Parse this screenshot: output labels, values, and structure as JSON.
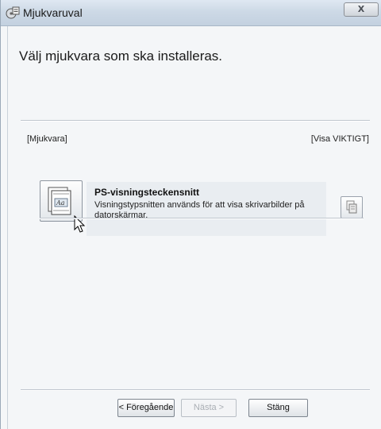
{
  "window": {
    "title": "Mjukvaruval",
    "close_label": "X"
  },
  "page": {
    "heading": "Välj mjukvara som ska installeras."
  },
  "list": {
    "left_header": "[Mjukvara]",
    "right_header": "[Visa VIKTIGT]",
    "items": [
      {
        "name": "PS-visningsteckensnitt",
        "description": "Visningstypsnitten används för att visa skrivarbilder på datorskärmar.",
        "icon": "font-document-icon",
        "info_icon": "copy-pages-icon"
      }
    ]
  },
  "buttons": {
    "back": "< Föregående",
    "next": "Nästa >",
    "close": "Stäng"
  }
}
